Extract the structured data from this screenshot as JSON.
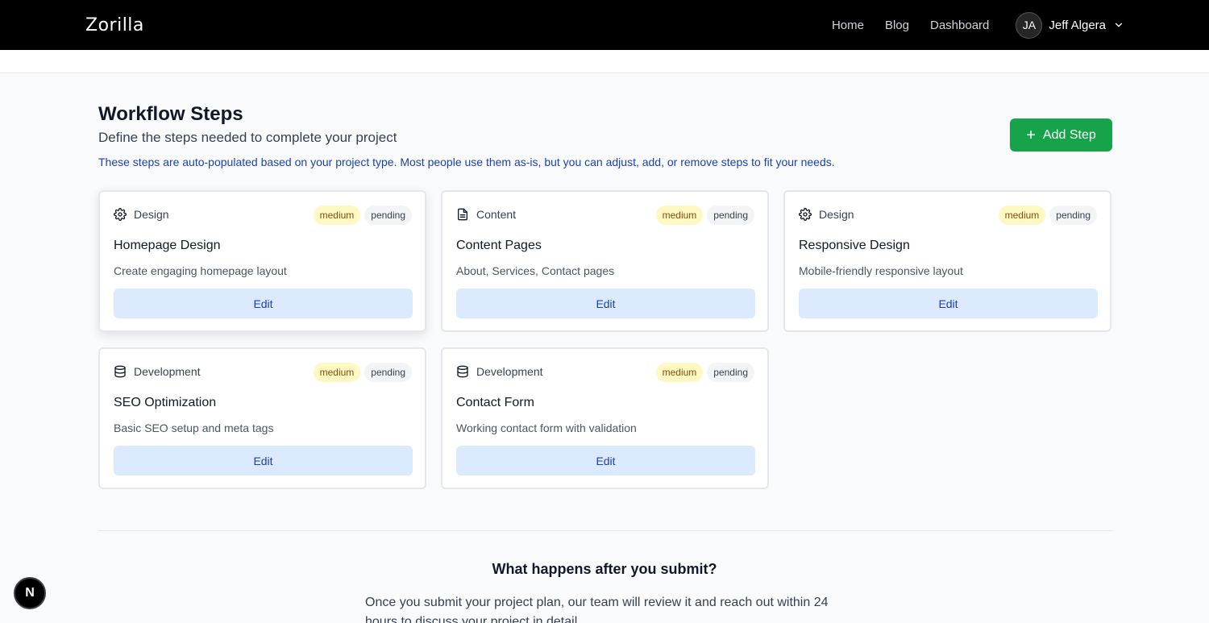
{
  "navbar": {
    "logo": "Zorilla",
    "links": [
      "Home",
      "Blog",
      "Dashboard"
    ],
    "user": {
      "initials": "JA",
      "name": "Jeff Algera"
    }
  },
  "section": {
    "title": "Workflow Steps",
    "subtitle": "Define the steps needed to complete your project",
    "info": "These steps are auto-populated based on your project type. Most people use them as-is, but you can adjust, add, or remove steps to fit your needs.",
    "add_button": "Add Step"
  },
  "steps": [
    {
      "category": "Design",
      "icon": "gear-icon",
      "priority": "medium",
      "status": "pending",
      "title": "Homepage Design",
      "description": "Create engaging homepage layout",
      "edit_label": "Edit"
    },
    {
      "category": "Content",
      "icon": "document-icon",
      "priority": "medium",
      "status": "pending",
      "title": "Content Pages",
      "description": "About, Services, Contact pages",
      "edit_label": "Edit"
    },
    {
      "category": "Design",
      "icon": "gear-icon",
      "priority": "medium",
      "status": "pending",
      "title": "Responsive Design",
      "description": "Mobile-friendly responsive layout",
      "edit_label": "Edit"
    },
    {
      "category": "Development",
      "icon": "database-icon",
      "priority": "medium",
      "status": "pending",
      "title": "SEO Optimization",
      "description": "Basic SEO setup and meta tags",
      "edit_label": "Edit"
    },
    {
      "category": "Development",
      "icon": "database-icon",
      "priority": "medium",
      "status": "pending",
      "title": "Contact Form",
      "description": "Working contact form with validation",
      "edit_label": "Edit"
    }
  ],
  "after_submit": {
    "title": "What happens after you submit?",
    "text": "Once you submit your project plan, our team will review it and reach out within 24 hours to discuss your project in detail."
  },
  "dev_badge": "N"
}
